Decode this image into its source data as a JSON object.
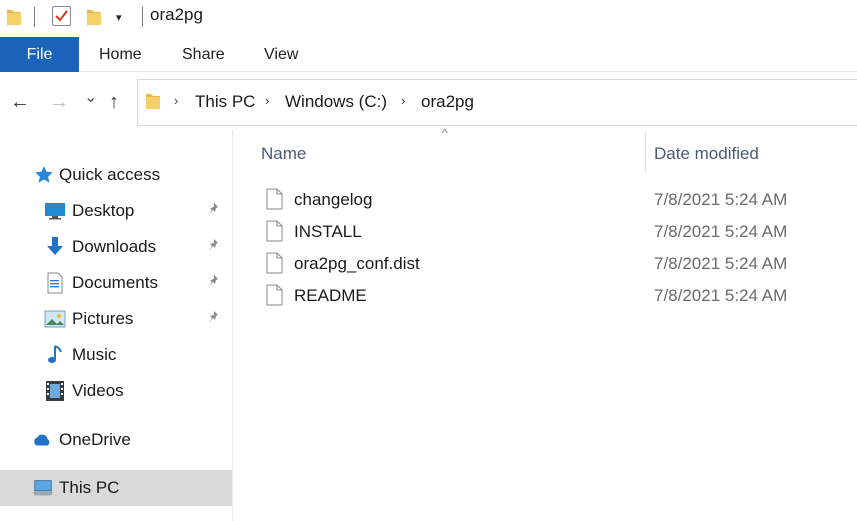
{
  "window": {
    "title": "ora2pg"
  },
  "quick_access_toolbar": {
    "icons": [
      "folder-icon",
      "properties-check-icon",
      "new-folder-icon",
      "customize-dropdown-icon"
    ],
    "dropdown_glyph": "▾"
  },
  "ribbon": {
    "tabs": [
      {
        "label": "File",
        "active": true
      },
      {
        "label": "Home"
      },
      {
        "label": "Share"
      },
      {
        "label": "View"
      }
    ],
    "accent_color": "#1a63b8"
  },
  "navigation": {
    "back": "←",
    "forward": "→",
    "recent": "⌄",
    "up": "↑"
  },
  "address_bar": {
    "breadcrumbs": [
      "This PC",
      "Windows (C:)",
      "ora2pg"
    ],
    "separator": "›"
  },
  "sidebar": {
    "items": [
      {
        "label": "Quick access",
        "icon": "star-icon",
        "pinned": false
      },
      {
        "label": "Desktop",
        "icon": "desktop-icon",
        "pinned": true
      },
      {
        "label": "Downloads",
        "icon": "download-arrow-icon",
        "pinned": true
      },
      {
        "label": "Documents",
        "icon": "documents-icon",
        "pinned": true
      },
      {
        "label": "Pictures",
        "icon": "pictures-icon",
        "pinned": true
      },
      {
        "label": "Music",
        "icon": "music-note-icon",
        "pinned": false
      },
      {
        "label": "Videos",
        "icon": "film-icon",
        "pinned": false
      },
      {
        "label": "OneDrive",
        "icon": "cloud-icon",
        "pinned": false
      },
      {
        "label": "This PC",
        "icon": "computer-icon",
        "pinned": false,
        "selected": true
      }
    ],
    "pin_glyph": "📌"
  },
  "file_list": {
    "sort_indicator": "^",
    "columns": [
      "Name",
      "Date modified"
    ],
    "rows": [
      {
        "name": "changelog",
        "date": "7/8/2021 5:24 AM"
      },
      {
        "name": "INSTALL",
        "date": "7/8/2021 5:24 AM"
      },
      {
        "name": "ora2pg_conf.dist",
        "date": "7/8/2021 5:24 AM"
      },
      {
        "name": "README",
        "date": "7/8/2021 5:24 AM"
      }
    ]
  }
}
